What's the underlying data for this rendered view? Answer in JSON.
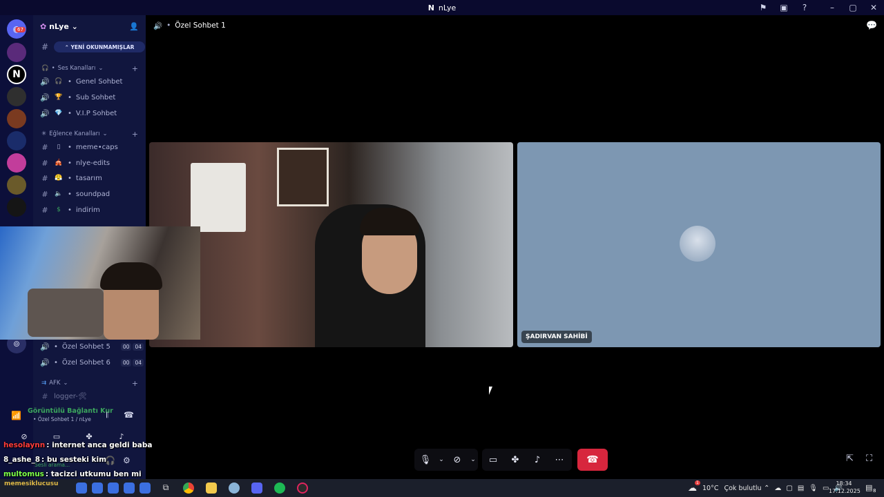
{
  "window": {
    "title": "nLye"
  },
  "guilds": {
    "badge": "67"
  },
  "server": {
    "name": "nLye",
    "unread_label": "YENİ OKUNMAMIŞLAR"
  },
  "categories": [
    {
      "label": "Ses Kanalları"
    },
    {
      "label": "Eğlence Kanalları"
    },
    {
      "label": "AFK"
    }
  ],
  "voice_channels": [
    {
      "emoji": "🎧",
      "label": "Genel Sohbet"
    },
    {
      "emoji": "🏆",
      "label": "Sub Sohbet"
    },
    {
      "emoji": "💎",
      "label": "V.I.P Sohbet"
    }
  ],
  "text_channels": [
    {
      "emoji": "▯",
      "label": "meme•caps"
    },
    {
      "emoji": "🎪",
      "label": "nlye-edits"
    },
    {
      "emoji": "😤",
      "label": "tasarım"
    },
    {
      "emoji": "🔈",
      "label": "soundpad"
    },
    {
      "emoji": "$",
      "label": "indirim"
    }
  ],
  "private_channels": [
    {
      "label": "Özel Sohbet 5",
      "c1": "00",
      "c2": "04"
    },
    {
      "label": "Özel Sohbet 6",
      "c1": "00",
      "c2": "04"
    }
  ],
  "afk_channel": {
    "label": "logger-🛠"
  },
  "call": {
    "channel_name": "Özel Sohbet 1",
    "participant2_name": "ŞADIRVAN SAHİBİ"
  },
  "voice_panel": {
    "title": "Görüntülü Bağlantı Kur",
    "subtitle": "Özel Sohbet 1 / nLye",
    "status": "Sesli arama..."
  },
  "chat": [
    {
      "user": "hesolaynn",
      "user_color": "#ff3b3b",
      "text": ": internet anca geldi baba"
    },
    {
      "user": "8_ashe_8",
      "user_color": "#ffffff",
      "text": ": bu sesteki kim"
    },
    {
      "user": "multomus",
      "user_color": "#7dff4a",
      "text": ": tacizci utkumu ben mi"
    }
  ],
  "taskbar": {
    "temperature": "10°C",
    "weather": "Çok bulutlu",
    "weather_badge": "1",
    "time": "18:34",
    "date": "17.12.2025",
    "notif_count": "8",
    "partial_text": "memesiklucusu"
  },
  "colors": {
    "end_call": "#d7263d",
    "connected": "#3ba55d",
    "accent": "#5865f2"
  }
}
